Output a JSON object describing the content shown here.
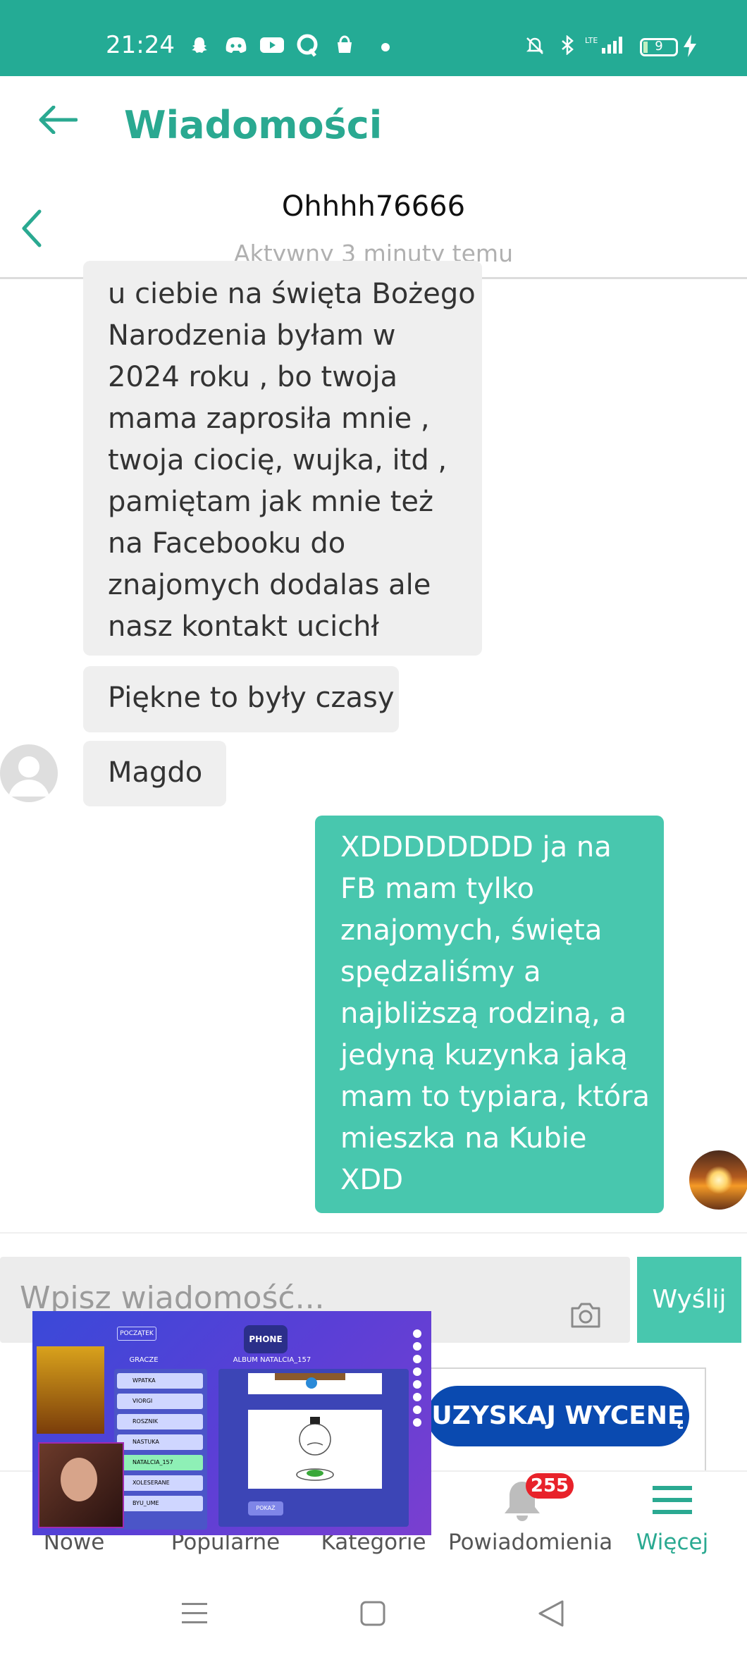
{
  "status_bar": {
    "time": "21:24",
    "battery": "9"
  },
  "header": {
    "title": "Wiadomości"
  },
  "conversation": {
    "name": "Ohhhh76666",
    "status": "Aktywny 3 minuty temu"
  },
  "messages": [
    {
      "from": "other",
      "text": "u ciebie na święta Bożego\nNarodzenia byłam w\n2024 roku , bo twoja\nmama zaprosiła mnie ,\ntwoja ciocię, wujka, itd ,\npamiętam jak mnie też\nna Facebooku do\nznajomych dodalas ale\nnasz kontakt ucichł"
    },
    {
      "from": "other",
      "text": "Piękne to były czasy"
    },
    {
      "from": "other",
      "text": "Magdo"
    },
    {
      "from": "me",
      "text": "XDDDDDDDD ja na\nFB mam tylko\nznajomych, święta\nspędzaliśmy a\nnajbliższą rodziną, a\njedyną kuzynka jaką\nmam to typiara, która\nmieszka na Kubie\nXDD"
    }
  ],
  "composer": {
    "placeholder": "Wpisz wiadomość...",
    "send_label": "Wyślij"
  },
  "ad": {
    "button_label": "UZYSKAJ WYCENĘ"
  },
  "bottom_nav": {
    "items": [
      {
        "label": "Nowe"
      },
      {
        "label": "Popularne"
      },
      {
        "label": "Kategorie"
      },
      {
        "label": "Powiadomienia",
        "badge": "255"
      },
      {
        "label": "Więcej",
        "active": true
      }
    ]
  },
  "pip": {
    "game_title": "PHONE",
    "players_header": "GRACZE",
    "album_header": "ALBUM NATALCIA_157",
    "players": [
      "WPATKA",
      "VIORGI",
      "ROSZNIK",
      "NASTUKA",
      "NATALCIA_157",
      "XOLESERANE",
      "BYU_UME"
    ],
    "start_label": "POCZĄTEK",
    "next_label": "POKAŻ"
  },
  "colors": {
    "brand": "#24ab95",
    "bubble_out": "#48c7ae",
    "bubble_in": "#efefef",
    "ad_button": "#0a4ab0",
    "badge": "#e8222a"
  }
}
